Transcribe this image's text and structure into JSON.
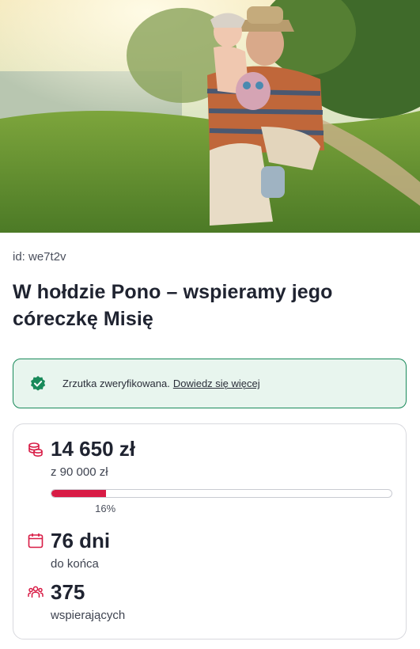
{
  "campaign": {
    "id_text": "id: we7t2v",
    "title": "W hołdzie Pono – wspieramy jego córeczkę Misię"
  },
  "verification": {
    "text": "Zrzutka zweryfikowana.",
    "link": "Dowiedz się więcej",
    "icon": "verified-check-icon",
    "color": "#198a5a"
  },
  "stats": {
    "raised": "14 650 zł",
    "goal": "z 90 000 zł",
    "progress_fraction": 0.16,
    "progress_label": "16%",
    "days_left": "76 dni",
    "days_caption": "do końca",
    "supporters": "375",
    "supporters_caption": "wspierających",
    "accent_color": "#d81b45",
    "icons": [
      "coins-icon",
      "calendar-icon",
      "people-icon"
    ]
  }
}
